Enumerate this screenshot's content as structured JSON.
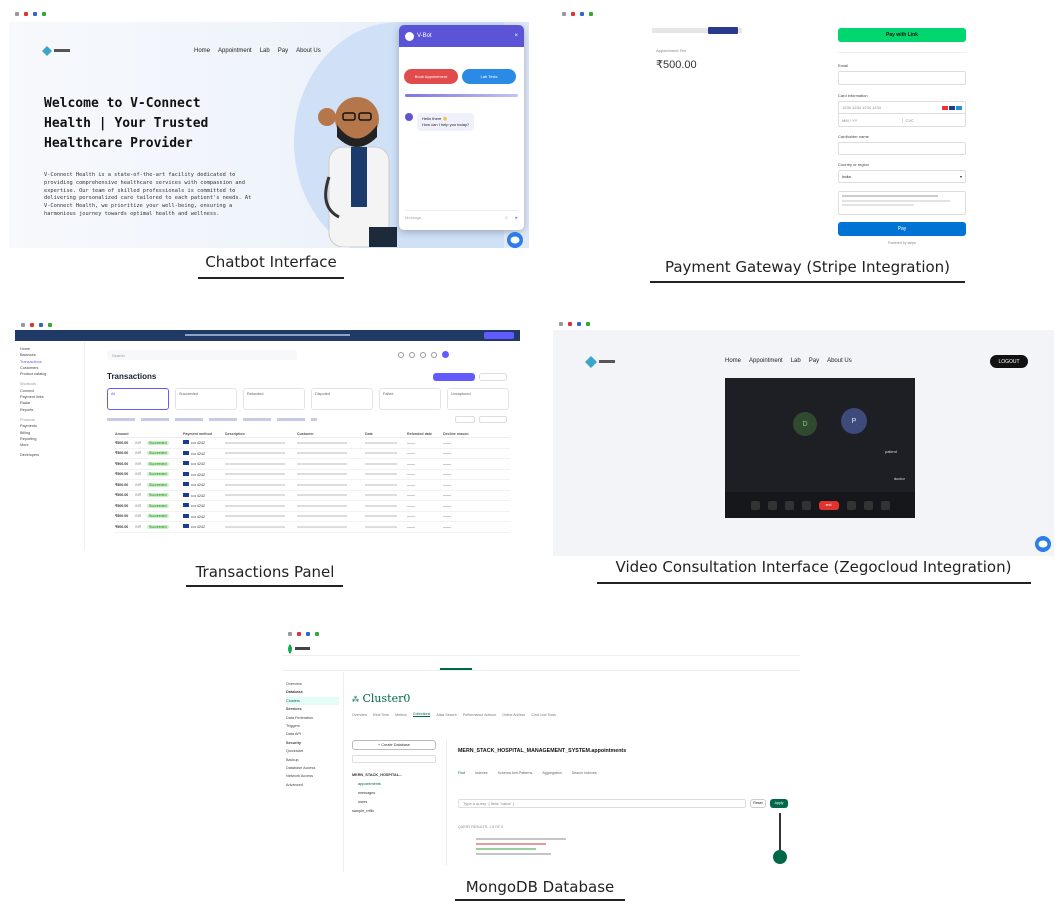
{
  "captions": {
    "chatbot": "Chatbot Interface",
    "payment": "Payment Gateway (Stripe Integration)",
    "transactions": "Transactions Panel",
    "video": "Video Consultation Interface (Zegocloud Integration)",
    "mongo": "MongoDB Database"
  },
  "chatbot": {
    "nav": [
      "Home",
      "Appointment",
      "Lab",
      "Pay",
      "About Us"
    ],
    "hero_title_1": "Welcome to V-Connect",
    "hero_title_2": "Health | Your Trusted",
    "hero_title_3": "Healthcare Provider",
    "hero_body": "V-Connect Health is a state-of-the-art facility dedicated to providing comprehensive healthcare services with compassion and expertise. Our team of skilled professionals is committed to delivering personalized care tailored to each patient's needs. At V-Connect Health, we prioritize your well-being, ensuring a harmonious journey towards optimal health and wellness.",
    "chat_header": "V-Bot",
    "chat_btn_1": "Book Appointment",
    "chat_btn_2": "Lab Tests",
    "chat_msg_1": "Hello there 👋",
    "chat_msg_2": "How can I help you today?",
    "chat_input_placeholder": "Message...",
    "accent": "#5b54d6"
  },
  "payment": {
    "price_caption": "Appointment Fee",
    "price": "₹500.00",
    "pay_button_top": "Pay with Link",
    "email_label": "Email",
    "card_label": "Card information",
    "card_placeholder": "1234 1234 1234 1234",
    "expiry_placeholder": "MM / YY",
    "cvc_placeholder": "CVC",
    "name_label": "Cardholder name",
    "country_label": "Country or region",
    "country_value": "India",
    "pay_button": "Pay",
    "footer": "Powered by stripe"
  },
  "transactions": {
    "title": "Transactions",
    "search_placeholder": "Search",
    "filters": [
      "All",
      "Succeeded",
      "Refunded",
      "Disputed",
      "Failed",
      "Uncaptured"
    ],
    "columns": [
      "Amount",
      "",
      "Payment method",
      "Description",
      "Customer",
      "Date",
      "Refunded date",
      "Decline reason"
    ],
    "rows": [
      {
        "amount": "₹500.00",
        "currency": "INR",
        "status": "Succeeded",
        "method": "•••• 4242"
      },
      {
        "amount": "₹500.00",
        "currency": "INR",
        "status": "Succeeded",
        "method": "•••• 4242"
      },
      {
        "amount": "₹500.00",
        "currency": "INR",
        "status": "Succeeded",
        "method": "•••• 4242"
      },
      {
        "amount": "₹500.00",
        "currency": "INR",
        "status": "Succeeded",
        "method": "•••• 4242"
      },
      {
        "amount": "₹500.00",
        "currency": "INR",
        "status": "Succeeded",
        "method": "•••• 4242"
      },
      {
        "amount": "₹500.00",
        "currency": "INR",
        "status": "Succeeded",
        "method": "•••• 4242"
      },
      {
        "amount": "₹500.00",
        "currency": "INR",
        "status": "Succeeded",
        "method": "•••• 4242"
      },
      {
        "amount": "₹500.00",
        "currency": "INR",
        "status": "Succeeded",
        "method": "•••• 4242"
      },
      {
        "amount": "₹500.00",
        "currency": "INR",
        "status": "Succeeded",
        "method": "•••• 4242"
      }
    ],
    "sidebar": [
      "Home",
      "Balances",
      "Transactions",
      "Customers",
      "Product catalog",
      "Shortcuts",
      "Connect",
      "Payment links",
      "Radar",
      "Reports",
      "Products",
      "Payments",
      "Billing",
      "Reporting",
      "More",
      "Developers"
    ],
    "banner_accent": "#635bff"
  },
  "video": {
    "nav": [
      "Home",
      "Appointment",
      "Lab",
      "Pay",
      "About Us"
    ],
    "logout": "LOGOUT",
    "tile_1_initial": "D",
    "tile_2_initial": "P",
    "tile_2_name": "patient",
    "tile_1_name": "doctor",
    "end_call": "end"
  },
  "mongo": {
    "cluster": "Cluster0",
    "namespace": "MERN_STACK_HOSPITAL_MANAGEMENT_SYSTEM.appointments",
    "tabs": [
      "Overview",
      "Real Time",
      "Metrics",
      "Collections",
      "Atlas Search",
      "Performance Advisor",
      "Online Archive",
      "Cmd Line Tools"
    ],
    "sub_tabs": [
      "Find",
      "Indexes",
      "Schema Anti-Patterns",
      "Aggregation",
      "Search Indexes"
    ],
    "create_db_button": "+ Create Database",
    "databases": [
      "MERN_STACK_HOSPITAL...",
      "appointments",
      "messages",
      "users",
      "sample_mflix"
    ],
    "left_nav": [
      "Overview",
      "Database",
      "Clusters",
      "Services",
      "Data Federation",
      "Triggers",
      "Data API",
      "Security",
      "Quickstart",
      "Backup",
      "Database Access",
      "Network Access",
      "Advanced"
    ],
    "filter_placeholder": "Type a query: { field: 'value' }",
    "apply_button": "Apply",
    "reset_button": "Reset",
    "query_results": "QUERY RESULTS: 1-5 OF 5",
    "accent": "#00684a"
  }
}
